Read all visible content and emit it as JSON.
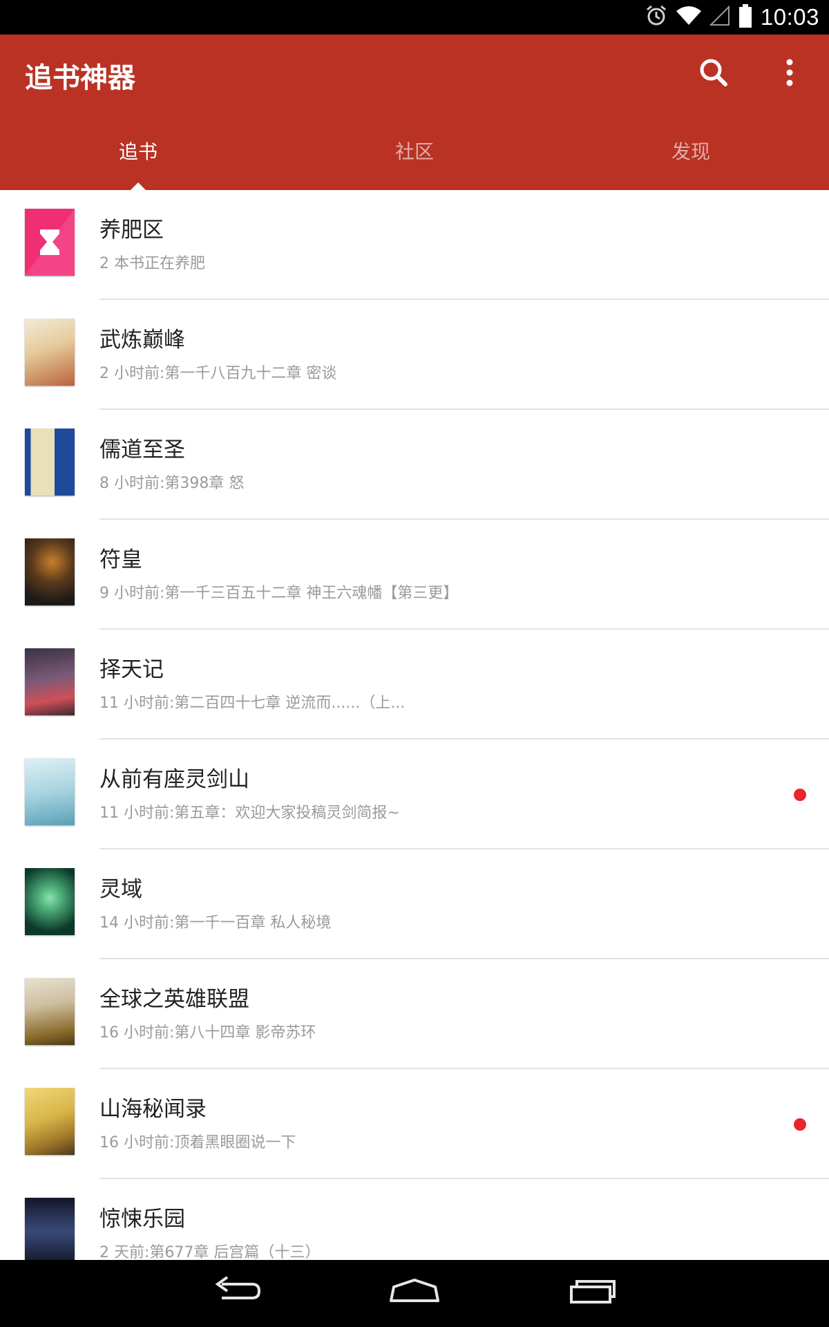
{
  "status_bar": {
    "time": "10:03",
    "icons": [
      "alarm-icon",
      "wifi-icon",
      "cell-signal-icon",
      "battery-icon"
    ]
  },
  "app_bar": {
    "title": "追书神器",
    "background_color": "#b93224",
    "actions": [
      "search-icon",
      "more-vert-icon"
    ]
  },
  "tabs": [
    {
      "label": "追书",
      "active": true
    },
    {
      "label": "社区",
      "active": false
    },
    {
      "label": "发现",
      "active": false
    }
  ],
  "books": [
    {
      "title": "养肥区",
      "subtitle": "2 本书正在养肥",
      "unread": false,
      "cover": "hourglass-icon",
      "cover_colors": [
        "#ef2f74",
        "#f55a9a"
      ]
    },
    {
      "title": "武炼巅峰",
      "subtitle": "2 小时前:第一千八百九十二章 密谈",
      "unread": false,
      "cover": "book-cover",
      "cover_colors": [
        "#f3ecd8",
        "#b9633a"
      ]
    },
    {
      "title": "儒道至圣",
      "subtitle": "8 小时前:第398章 怒",
      "unread": false,
      "cover": "book-cover",
      "cover_colors": [
        "#1f4a9a",
        "#e8e0b8"
      ]
    },
    {
      "title": "符皇",
      "subtitle": "9 小时前:第一千三百五十二章 神王六魂幡【第三更】",
      "unread": false,
      "cover": "book-cover",
      "cover_colors": [
        "#1c1a18",
        "#c8802c"
      ]
    },
    {
      "title": "择天记",
      "subtitle": "11 小时前:第二百四十七章 逆流而......（上...",
      "unread": false,
      "cover": "book-cover",
      "cover_colors": [
        "#3a3140",
        "#cf4f57"
      ]
    },
    {
      "title": "从前有座灵剑山",
      "subtitle": "11 小时前:第五章：欢迎大家投稿灵剑简报~",
      "unread": true,
      "cover": "book-cover",
      "cover_colors": [
        "#dff0f4",
        "#5aa0b8"
      ]
    },
    {
      "title": "灵域",
      "subtitle": "14 小时前:第一千一百章  私人秘境",
      "unread": false,
      "cover": "book-cover",
      "cover_colors": [
        "#0c3a2a",
        "#4fb07a"
      ]
    },
    {
      "title": "全球之英雄联盟",
      "subtitle": "16 小时前:第八十四章 影帝苏环",
      "unread": false,
      "cover": "book-cover",
      "cover_colors": [
        "#cdbfa0",
        "#8a6a2a"
      ]
    },
    {
      "title": "山海秘闻录",
      "subtitle": "16 小时前:顶着黑眼圈说一下",
      "unread": true,
      "cover": "book-cover",
      "cover_colors": [
        "#d8b548",
        "#4a3a1a"
      ]
    },
    {
      "title": "惊悚乐园",
      "subtitle": "2 天前:第677章 后宫篇（十三）",
      "unread": false,
      "cover": "book-cover",
      "cover_colors": [
        "#121628",
        "#3a4a78"
      ]
    }
  ],
  "nav_bar": [
    "back-icon",
    "home-icon",
    "recents-icon"
  ],
  "colors": {
    "accent": "#b93224",
    "unread_dot": "#e8262b",
    "title_text": "#222222",
    "subtitle_text": "#9a9a9a",
    "divider": "#e2e2e2"
  }
}
